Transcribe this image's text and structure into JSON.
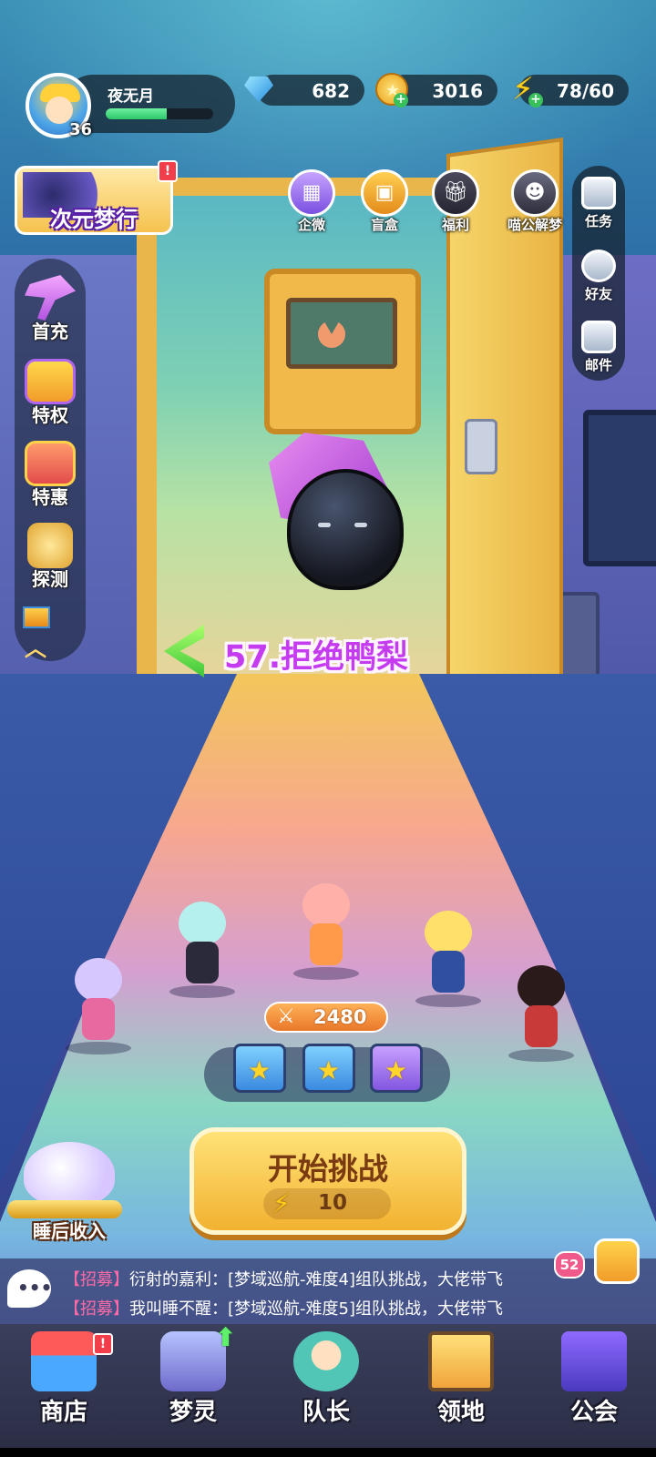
{
  "player": {
    "name": "夜无月",
    "level": "36",
    "exp_progress": 0.57
  },
  "resources": {
    "gems": "682",
    "coins": "3016",
    "energy": "78/60"
  },
  "event_banner": {
    "label": "次元梦行",
    "badge": "!"
  },
  "top_icons": [
    {
      "label": "企微",
      "icon": "gift-box-icon"
    },
    {
      "label": "盲盒",
      "icon": "card-pack-icon"
    },
    {
      "label": "福利",
      "icon": "present-icon"
    },
    {
      "label": "喵公解梦",
      "icon": "cat-icon"
    }
  ],
  "right_menu": [
    {
      "label": "任务",
      "icon": "clipboard-icon"
    },
    {
      "label": "好友",
      "icon": "friends-icon"
    },
    {
      "label": "邮件",
      "icon": "mail-icon"
    }
  ],
  "left_menu": [
    {
      "label": "首充",
      "icon": "hammer-icon"
    },
    {
      "label": "特权",
      "icon": "ticket-icon"
    },
    {
      "label": "特惠",
      "icon": "gift-icon"
    },
    {
      "label": "探测",
      "icon": "radar-icon"
    }
  ],
  "level": {
    "title": "57.拒绝鸭梨"
  },
  "team": {
    "power": "2480"
  },
  "start_button": {
    "label": "开始挑战",
    "cost": "10"
  },
  "sleep_income": {
    "label": "睡后收入"
  },
  "chat": {
    "messages": [
      {
        "tag": "【招募】",
        "text": "衍射的嘉利：[梦域巡航-难度4]组队挑战，大佬带飞"
      },
      {
        "tag": "【招募】",
        "text": "我叫睡不醒：[梦域巡航-难度5]组队挑战，大佬带飞"
      }
    ],
    "unread": "52"
  },
  "bottom_nav": [
    {
      "label": "商店",
      "badge": "!"
    },
    {
      "label": "梦灵"
    },
    {
      "label": "队长"
    },
    {
      "label": "领地"
    },
    {
      "label": "公会"
    }
  ]
}
